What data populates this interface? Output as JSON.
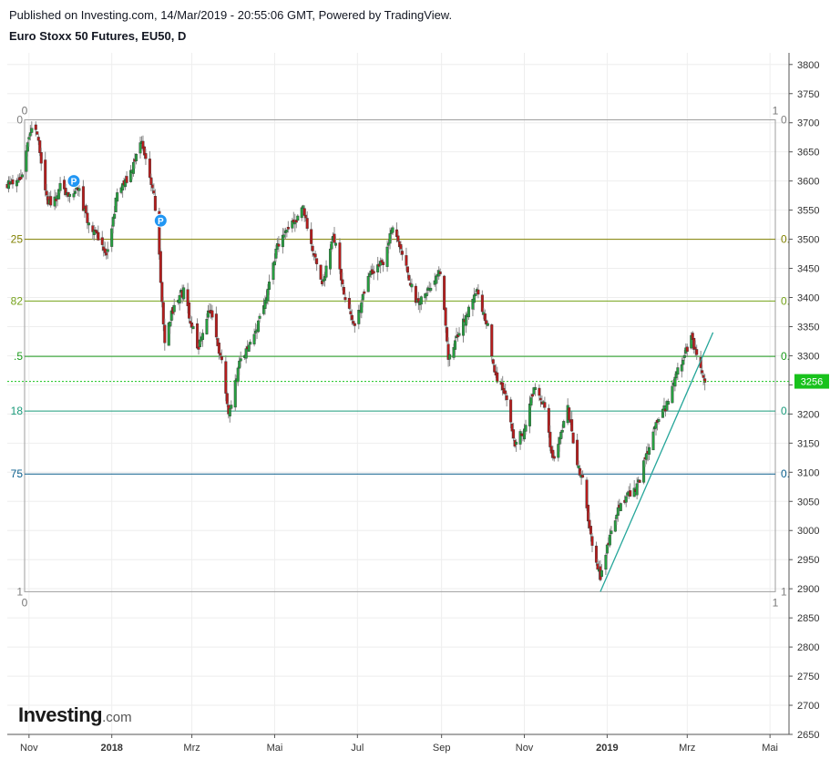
{
  "header": {
    "published": "Published on Investing.com, 14/Mar/2019 - 20:55:06 GMT, Powered by TradingView.",
    "instrument": "Euro Stoxx 50 Futures, EU50, D"
  },
  "logo": {
    "brand": "Investing",
    "suffix": ".com"
  },
  "colors": {
    "up": "#26a040",
    "down": "#b71c1c",
    "grid": "#eeeeee",
    "axis": "#555555",
    "last_price_bg": "#18c21c",
    "trendline": "#26a69a",
    "marker": "#2196f3"
  },
  "chart_data": {
    "type": "candlestick",
    "title": "Euro Stoxx 50 Futures, EU50, D",
    "ylim": [
      2650,
      3820
    ],
    "y_ticks": [
      3800,
      3750,
      3700,
      3650,
      3600,
      3550,
      3500,
      3450,
      3400,
      3350,
      3300,
      3250,
      3200,
      3150,
      3100,
      3050,
      3000,
      2950,
      2900,
      2850,
      2800,
      2750,
      2700,
      2650
    ],
    "y_tick_labels": [
      "3800",
      "3750",
      "3700",
      "3650",
      "3600",
      "3550",
      "3500",
      "3450",
      "3400",
      "3350",
      "3300",
      "3250",
      "3200",
      "3150",
      "3100",
      "3050",
      "3000",
      "2950",
      "2900",
      "2850",
      "2800",
      "2750",
      "2700",
      "2650"
    ],
    "x_range": [
      "2017-10-16",
      "2019-05-15"
    ],
    "x_ticks": [
      {
        "date": "2017-11-01",
        "label": "Nov",
        "bold": false
      },
      {
        "date": "2018-01-01",
        "label": "2018",
        "bold": true
      },
      {
        "date": "2018-03-01",
        "label": "Mrz",
        "bold": false
      },
      {
        "date": "2018-05-01",
        "label": "Mai",
        "bold": false
      },
      {
        "date": "2018-07-01",
        "label": "Jul",
        "bold": false
      },
      {
        "date": "2018-09-01",
        "label": "Sep",
        "bold": false
      },
      {
        "date": "2018-11-01",
        "label": "Nov",
        "bold": false
      },
      {
        "date": "2019-01-01",
        "label": "2019",
        "bold": true
      },
      {
        "date": "2019-03-01",
        "label": "Mrz",
        "bold": false
      },
      {
        "date": "2019-05-01",
        "label": "Mai",
        "bold": false
      }
    ],
    "last_price": 3256,
    "last_price_label": "3256",
    "price_path": [
      [
        "2017-10-16",
        3595
      ],
      [
        "2017-10-27",
        3605
      ],
      [
        "2017-11-02",
        3690
      ],
      [
        "2017-11-07",
        3680
      ],
      [
        "2017-11-15",
        3560
      ],
      [
        "2017-11-21",
        3570
      ],
      [
        "2017-11-24",
        3595
      ],
      [
        "2017-12-01",
        3570
      ],
      [
        "2017-12-07",
        3590
      ],
      [
        "2017-12-14",
        3530
      ],
      [
        "2017-12-29",
        3475
      ],
      [
        "2018-01-05",
        3580
      ],
      [
        "2018-01-12",
        3600
      ],
      [
        "2018-01-23",
        3665
      ],
      [
        "2018-02-01",
        3580
      ],
      [
        "2018-02-05",
        3470
      ],
      [
        "2018-02-09",
        3320
      ],
      [
        "2018-02-14",
        3375
      ],
      [
        "2018-02-23",
        3410
      ],
      [
        "2018-03-05",
        3310
      ],
      [
        "2018-03-14",
        3380
      ],
      [
        "2018-03-23",
        3290
      ],
      [
        "2018-03-28",
        3200
      ],
      [
        "2018-04-05",
        3285
      ],
      [
        "2018-04-13",
        3320
      ],
      [
        "2018-04-24",
        3390
      ],
      [
        "2018-05-03",
        3490
      ],
      [
        "2018-05-15",
        3530
      ],
      [
        "2018-05-22",
        3555
      ],
      [
        "2018-05-29",
        3480
      ],
      [
        "2018-06-05",
        3420
      ],
      [
        "2018-06-13",
        3510
      ],
      [
        "2018-06-21",
        3410
      ],
      [
        "2018-06-29",
        3350
      ],
      [
        "2018-07-10",
        3440
      ],
      [
        "2018-07-20",
        3460
      ],
      [
        "2018-07-27",
        3520
      ],
      [
        "2018-08-03",
        3480
      ],
      [
        "2018-08-13",
        3390
      ],
      [
        "2018-08-24",
        3420
      ],
      [
        "2018-08-31",
        3450
      ],
      [
        "2018-09-06",
        3300
      ],
      [
        "2018-09-14",
        3340
      ],
      [
        "2018-09-21",
        3385
      ],
      [
        "2018-09-27",
        3405
      ],
      [
        "2018-10-04",
        3360
      ],
      [
        "2018-10-11",
        3260
      ],
      [
        "2018-10-17",
        3240
      ],
      [
        "2018-10-25",
        3150
      ],
      [
        "2018-10-31",
        3170
      ],
      [
        "2018-11-08",
        3240
      ],
      [
        "2018-11-15",
        3220
      ],
      [
        "2018-11-22",
        3120
      ],
      [
        "2018-12-03",
        3210
      ],
      [
        "2018-12-10",
        3110
      ],
      [
        "2018-12-14",
        3090
      ],
      [
        "2018-12-21",
        2970
      ],
      [
        "2018-12-27",
        2920
      ],
      [
        "2019-01-03",
        2990
      ],
      [
        "2019-01-11",
        3050
      ],
      [
        "2019-01-22",
        3070
      ],
      [
        "2019-01-31",
        3140
      ],
      [
        "2019-02-07",
        3190
      ],
      [
        "2019-02-15",
        3220
      ],
      [
        "2019-02-22",
        3275
      ],
      [
        "2019-03-04",
        3330
      ],
      [
        "2019-03-08",
        3305
      ],
      [
        "2019-03-14",
        3256
      ]
    ],
    "fib_retracement": {
      "levels": [
        {
          "left_label": "0",
          "right_label": "0",
          "price": 3705,
          "color": "#808080"
        },
        {
          "left_label": "25",
          "right_label": "0.",
          "price": 3500,
          "color": "#808000"
        },
        {
          "left_label": "82",
          "right_label": "0.",
          "price": 3394,
          "color": "#75a21a"
        },
        {
          "left_label": ".5",
          "right_label": "0.",
          "price": 3299,
          "color": "#1a9a1a"
        },
        {
          "left_label": "18",
          "right_label": "0.",
          "price": 3205,
          "color": "#1a9a7a"
        },
        {
          "left_label": "75",
          "right_label": "0.",
          "price": 3097,
          "color": "#0a5e8c"
        },
        {
          "left_label": "1",
          "right_label": "1",
          "price": 2895,
          "color": "#808080"
        }
      ],
      "corner_labels": {
        "top_left": "0",
        "top_right": "1",
        "bottom_left": "0",
        "bottom_right": "1"
      }
    },
    "trendline": [
      [
        "2018-12-27",
        2895
      ],
      [
        "2019-03-20",
        3340
      ]
    ],
    "markers": [
      {
        "date": "2017-12-04",
        "price": 3600,
        "label": "P"
      },
      {
        "date": "2018-02-06",
        "price": 3532,
        "label": "P"
      }
    ]
  }
}
